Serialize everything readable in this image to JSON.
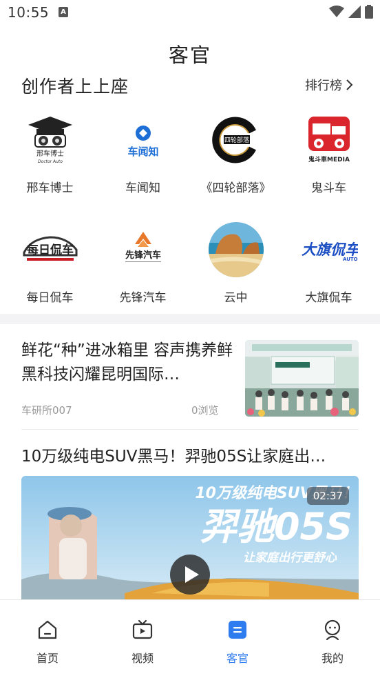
{
  "status_bar": {
    "time": "10:55"
  },
  "header": {
    "title": "客官"
  },
  "creators": {
    "title": "创作者上上座",
    "ranking_label": "排行榜",
    "items": [
      {
        "name": "邢车博士",
        "logo_text": "邢车博士"
      },
      {
        "name": "车闻知",
        "logo_text": "车闻知"
      },
      {
        "name": "《四轮部落》",
        "logo_text": "四轮部落"
      },
      {
        "name": "鬼斗车",
        "logo_text": "鬼斗車MEDIA"
      },
      {
        "name": "每日侃车",
        "logo_text": "每日侃车"
      },
      {
        "name": "先锋汽车",
        "logo_text": "先锋汽车"
      },
      {
        "name": "云中",
        "logo_text": ""
      },
      {
        "name": "大旗侃车",
        "logo_text": "大旗侃车"
      }
    ]
  },
  "feed": {
    "article": {
      "title": "鲜花“种”进冰箱里 容声携养鲜黑科技闪耀昆明国际…",
      "source": "车研所007",
      "views": "0浏览"
    },
    "video": {
      "title": "10万级纯电SUV黑马！羿驰05S让家庭出…",
      "duration": "02:37",
      "overlay_line1": "10万级纯电SUV黑马！",
      "overlay_line2": "羿驰05S",
      "overlay_line3": "让家庭出行更舒心"
    }
  },
  "tabs": [
    {
      "label": "首页",
      "icon": "home-icon"
    },
    {
      "label": "视频",
      "icon": "video-icon"
    },
    {
      "label": "客官",
      "icon": "article-icon",
      "active": true
    },
    {
      "label": "我的",
      "icon": "profile-icon"
    }
  ],
  "colors": {
    "accent": "#2f7bf0",
    "divider": "#f3f3f5"
  }
}
